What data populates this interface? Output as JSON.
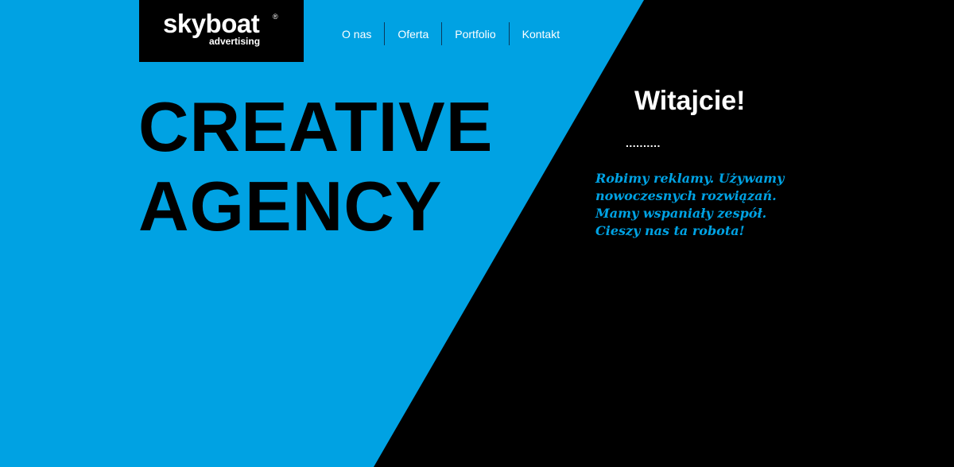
{
  "brand": {
    "name": "skyboat",
    "registered_mark": "®",
    "tagline": "advertising"
  },
  "nav": {
    "items": [
      {
        "label": "O nas"
      },
      {
        "label": "Oferta"
      },
      {
        "label": "Portfolio"
      },
      {
        "label": "Kontakt"
      }
    ]
  },
  "hero": {
    "title_line1": "CREATIVE",
    "title_line2": "AGENCY"
  },
  "welcome": {
    "heading": "Witajcie!",
    "dots": "..........",
    "lines": [
      "Robimy reklamy. Używamy",
      "nowoczesnych rozwiązań.",
      "Mamy wspaniały zespół.",
      "Cieszy nas ta robota!"
    ]
  },
  "colors": {
    "accent_blue": "#00a2e3",
    "background_black": "#000000",
    "text_white": "#ffffff"
  }
}
